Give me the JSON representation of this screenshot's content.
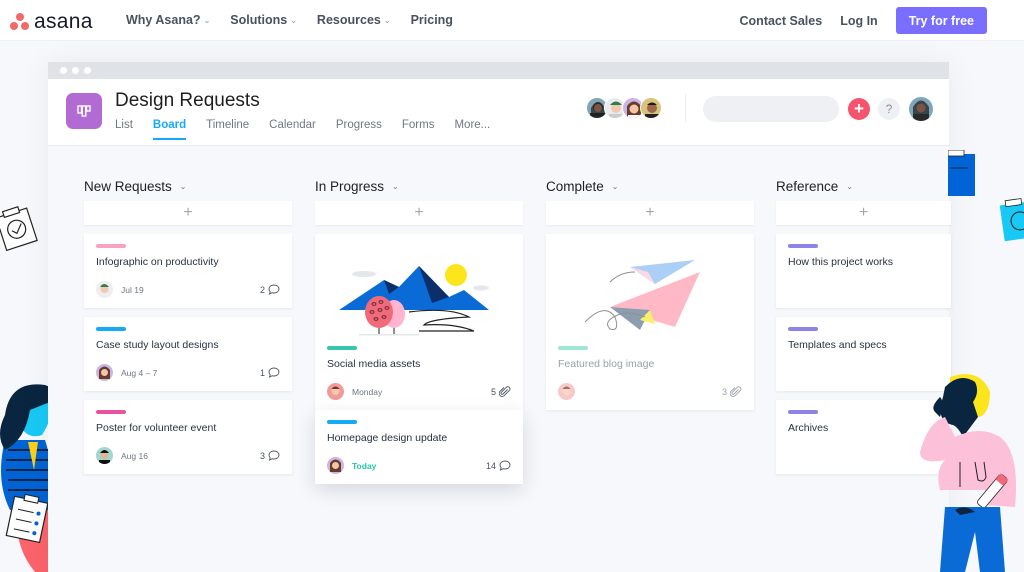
{
  "site_nav": {
    "logo_text": "asana",
    "links": [
      {
        "label": "Why Asana?",
        "dropdown": true
      },
      {
        "label": "Solutions",
        "dropdown": true
      },
      {
        "label": "Resources",
        "dropdown": true
      },
      {
        "label": "Pricing",
        "dropdown": false
      }
    ],
    "contact_sales": "Contact Sales",
    "log_in": "Log In",
    "try_free": "Try for free"
  },
  "project": {
    "title": "Design Requests",
    "icon": "board-icon",
    "icon_color": "#b36bd4",
    "tabs": [
      {
        "label": "List",
        "active": false
      },
      {
        "label": "Board",
        "active": true
      },
      {
        "label": "Timeline",
        "active": false
      },
      {
        "label": "Calendar",
        "active": false
      },
      {
        "label": "Progress",
        "active": false
      },
      {
        "label": "Forms",
        "active": false
      },
      {
        "label": "More...",
        "active": false
      }
    ],
    "search_placeholder": "",
    "add_symbol": "+",
    "help_symbol": "?"
  },
  "colors": {
    "accent": "#796eff",
    "active_tab": "#14aaf5",
    "add_button": "#f5546f"
  },
  "board": {
    "columns": [
      {
        "title": "New Requests",
        "add_symbol": "+",
        "cards": [
          {
            "tag_color": "#f8a1c0",
            "name": "Infographic on productivity",
            "due": "Jul 19",
            "count": "2",
            "count_icon": "comment-icon"
          },
          {
            "tag_color": "#14aaf5",
            "name": "Case study layout designs",
            "due": "Aug 4 – 7",
            "count": "1",
            "count_icon": "comment-icon"
          },
          {
            "tag_color": "#e8539d",
            "name": "Poster for volunteer event",
            "due": "Aug 16",
            "count": "3",
            "count_icon": "comment-icon"
          }
        ]
      },
      {
        "title": "In Progress",
        "add_symbol": "+",
        "cards": [
          {
            "tag_color": "#37c5ab",
            "name": "Social media assets",
            "due": "Monday",
            "count": "5",
            "count_icon": "attachment-icon",
            "illustration": "mountains"
          },
          {
            "tag_color": "#14aaf5",
            "name": "Homepage design update",
            "due": "Today",
            "due_today": true,
            "count": "14",
            "count_icon": "comment-icon"
          }
        ]
      },
      {
        "title": "Complete",
        "add_symbol": "+",
        "cards": [
          {
            "tag_color": "#9ee7d8",
            "name": "Featured blog image",
            "due": "",
            "count": "3",
            "count_icon": "attachment-icon",
            "illustration": "paper-planes",
            "completed": true
          }
        ]
      },
      {
        "title": "Reference",
        "add_symbol": "+",
        "cards": [
          {
            "tag_color": "#8d84e8",
            "name": "How this project works"
          },
          {
            "tag_color": "#8d84e8",
            "name": "Templates and specs"
          },
          {
            "tag_color": "#8d84e8",
            "name": "Archives"
          }
        ]
      }
    ]
  }
}
